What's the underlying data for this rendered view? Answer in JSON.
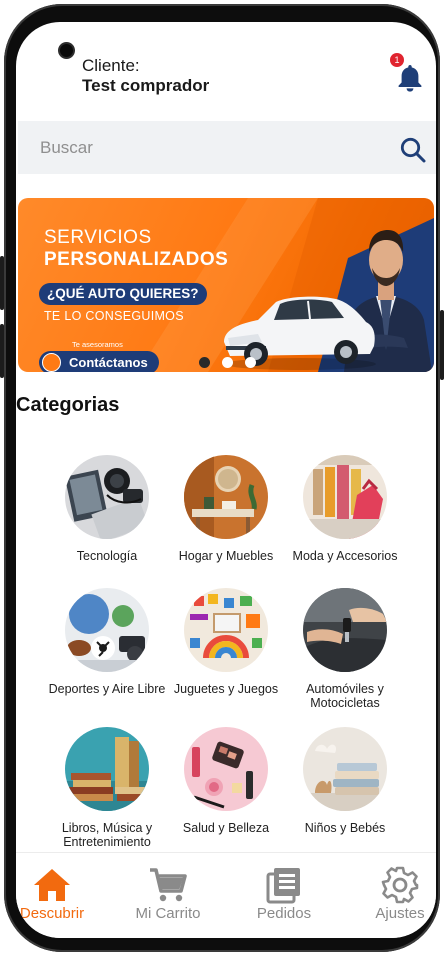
{
  "header": {
    "client_label": "Cliente:",
    "client_name": "Test comprador",
    "notification_count": "1"
  },
  "search": {
    "placeholder": "Buscar"
  },
  "banner": {
    "line1": "SERVICIOS",
    "line2": "PERSONALIZADOS",
    "question": "¿QUÉ AUTO QUIERES?",
    "line3": "TE LO CONSEGUIMOS",
    "advisor": "Te asesoramos",
    "contact": "Contáctanos",
    "slides": 3,
    "active_slide": 1
  },
  "categories": {
    "title": "Categorias",
    "items": [
      {
        "label": "Tecnología",
        "icon": "technology-photo"
      },
      {
        "label": "Hogar y Muebles",
        "icon": "home-furniture-photo"
      },
      {
        "label": "Moda y Accesorios",
        "icon": "fashion-photo"
      },
      {
        "label": "Deportes y Aire Libre",
        "icon": "sports-photo"
      },
      {
        "label": "Juguetes y Juegos",
        "icon": "toys-photo"
      },
      {
        "label": "Automóviles y Motocicletas",
        "icon": "car-keys-photo"
      },
      {
        "label": "Libros, Música y Entretenimiento",
        "icon": "books-photo"
      },
      {
        "label": "Salud y Belleza",
        "icon": "cosmetics-photo"
      },
      {
        "label": "Niños y Bebés",
        "icon": "baby-clothes-photo"
      }
    ]
  },
  "nav": {
    "items": [
      {
        "label": "Descubrir",
        "icon": "home-icon",
        "active": true
      },
      {
        "label": "Mi Carrito",
        "icon": "cart-icon",
        "active": false
      },
      {
        "label": "Pedidos",
        "icon": "orders-icon",
        "active": false
      },
      {
        "label": "Ajustes",
        "icon": "gear-icon",
        "active": false
      }
    ]
  },
  "colors": {
    "accent": "#f26a0f",
    "navy": "#1e3c78",
    "icon_blue": "#1f3f78",
    "badge": "#e0242f"
  }
}
